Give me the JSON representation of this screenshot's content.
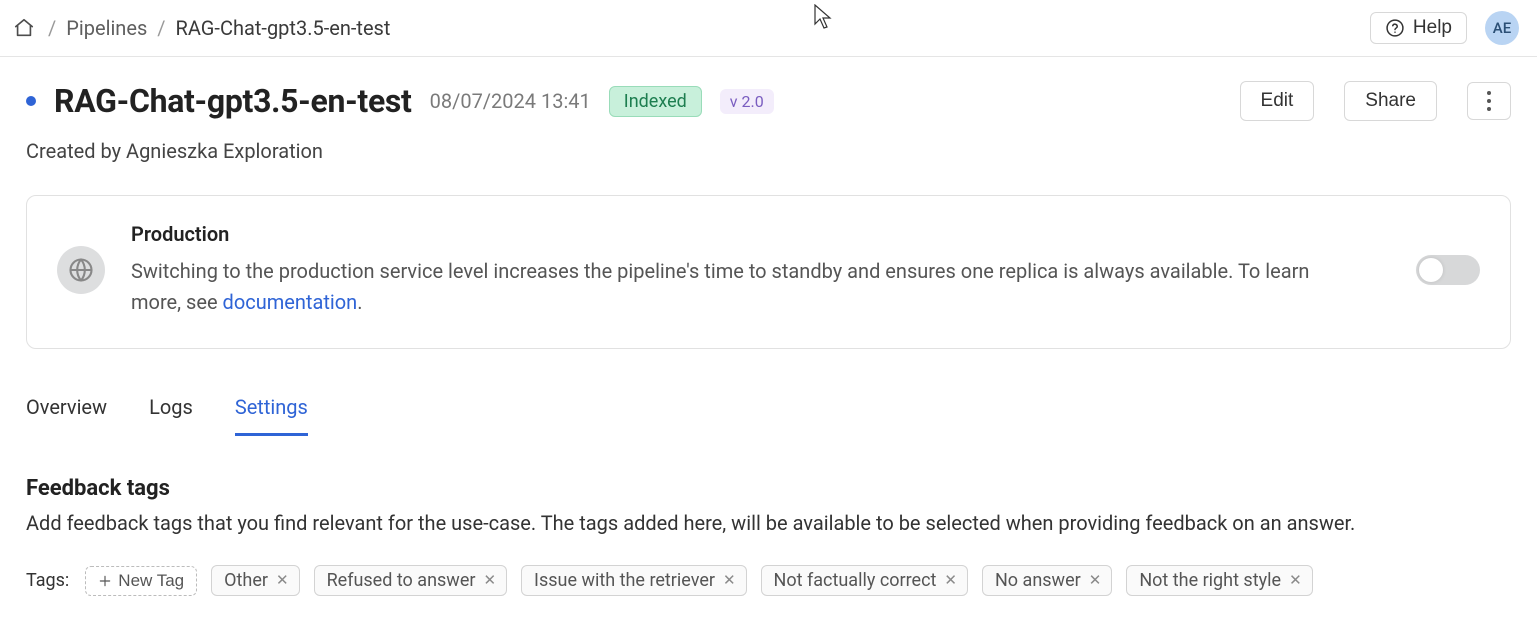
{
  "breadcrumb": {
    "pipelines": "Pipelines",
    "current": "RAG-Chat-gpt3.5-en-test"
  },
  "header": {
    "help": "Help",
    "avatar_initials": "AE"
  },
  "page": {
    "title": "RAG-Chat-gpt3.5-en-test",
    "datetime": "08/07/2024 13:41",
    "status_badge": "Indexed",
    "version_badge": "v 2.0",
    "edit": "Edit",
    "share": "Share",
    "created_by": "Created by Agnieszka Exploration"
  },
  "production_card": {
    "title": "Production",
    "description": "Switching to the production service level increases the pipeline's time to standby and ensures one replica is always available. To learn more, see ",
    "doc_link": "documentation",
    "suffix": ".",
    "enabled": false
  },
  "tabs": {
    "overview": "Overview",
    "logs": "Logs",
    "settings": "Settings"
  },
  "feedback": {
    "heading": "Feedback tags",
    "description": "Add feedback tags that you find relevant for the use-case. The tags added here, will be available to be selected when providing feedback on an answer.",
    "tags_label": "Tags:",
    "new_tag": "New Tag",
    "tags": [
      "Other",
      "Refused to answer",
      "Issue with the retriever",
      "Not factually correct",
      "No answer",
      "Not the right style"
    ]
  }
}
